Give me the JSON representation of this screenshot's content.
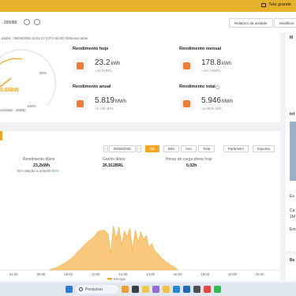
{
  "topbar": {
    "screen_button": "Tela grande"
  },
  "header": {
    "plant_id": ": 295089",
    "report_button": "Relatório da unidade",
    "modify_button": "Modificar"
  },
  "status": {
    "updated_text": "dados : 06/08/2025 16:01:27 (UTC-04:00) 0Minutos atrás",
    "gauge_power": "0,65kW",
    "gauge_label": "unidade : 1MWp",
    "gauge_pct_a": "50%",
    "gauge_pct_b": "100%"
  },
  "stats": {
    "today": {
      "title": "Rendimento hoje",
      "value": "23.2",
      "unit": "kWh",
      "sub": "≈26.91BRL"
    },
    "monthly": {
      "title": "Rendimento mensal",
      "value": "178.8",
      "unit": "kWh",
      "sub": "≈207.40BRL"
    },
    "annual": {
      "title": "Rendimento anual",
      "value": "5.819",
      "unit": "MWh",
      "sub": "≈6.74K BRL"
    },
    "total": {
      "title": "Rendimento total",
      "value": "5.946",
      "unit": "MWh",
      "sub": "≈6.897K BRL"
    }
  },
  "chart_controls": {
    "date": "06/08/2025",
    "tabs": [
      "Dia",
      "Mês",
      "Ano",
      "Total"
    ],
    "active_tab": "Dia",
    "param_button": "Parâmetro",
    "export_button": "Exportar"
  },
  "summary": {
    "daily_label": "Rendimento diário",
    "daily_value": "23,2kWh",
    "compare_text": "Em relação a ontem",
    "compare_value": "9,02%",
    "gain_label": "Ganho diário",
    "gain_value": "26,912BRL",
    "hours_label": "Horas de carga plena hoje",
    "hours_value": "0,02h"
  },
  "chart_data": {
    "type": "area",
    "x_ticks": [
      "04:00",
      "06:00",
      "08:00",
      "10:00",
      "12:00",
      "14:00",
      "16:00",
      "18:00",
      "20:00",
      "22:00"
    ],
    "xlim": [
      3.0,
      23.5
    ],
    "ylim": [
      0,
      100
    ],
    "color": "#f5a623",
    "x": [
      6.6,
      7.2,
      7.8,
      8.3,
      8.8,
      9.3,
      9.8,
      10.2,
      10.6,
      10.9,
      11.1,
      11.3,
      11.5,
      11.7,
      11.9,
      12.1,
      12.3,
      12.5,
      12.7,
      12.9,
      13.1,
      13.3,
      13.5,
      13.7,
      13.9,
      14.1,
      14.3,
      14.5,
      14.8,
      15.1,
      15.4,
      15.7,
      16.0
    ],
    "values": [
      0,
      5,
      13,
      22,
      35,
      48,
      58,
      70,
      72,
      65,
      30,
      80,
      55,
      78,
      45,
      70,
      60,
      75,
      35,
      73,
      50,
      68,
      55,
      62,
      40,
      48,
      35,
      30,
      22,
      15,
      10,
      6,
      0
    ],
    "legend": "Energia"
  },
  "right_panel": {
    "title_a": "M",
    "title_b": "Inf",
    "items": [
      "Es",
      "Ca",
      "1M",
      "Em"
    ],
    "title_c": "Be"
  },
  "taskbar": {
    "search_placeholder": "Pesquisar"
  }
}
